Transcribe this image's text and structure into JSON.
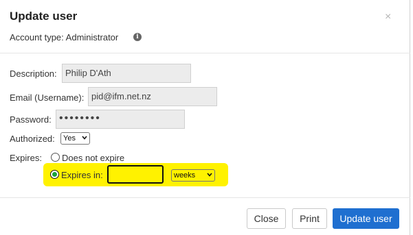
{
  "dialog": {
    "title": "Update user",
    "close_glyph": "×",
    "account_type": "Account type: Administrator",
    "info_icon": "info-circle-icon"
  },
  "form": {
    "description_label": "Description:",
    "description_value": "Philip D'Ath",
    "email_label": "Email (Username):",
    "email_value": "pid@ifm.net.nz",
    "password_label": "Password:",
    "password_value": "••••••••",
    "authorized_label": "Authorized:",
    "authorized_value": "Yes",
    "expires_label": "Expires:",
    "option_never": "Does not expire",
    "option_expires_in": "Expires in:",
    "expires_in_value": "",
    "unit_value": "weeks",
    "selected_option": "expires_in"
  },
  "footer": {
    "close_label": "Close",
    "print_label": "Print",
    "update_label": "Update user"
  },
  "colors": {
    "primary": "#1f6fd0",
    "highlight": "#fff200",
    "radio_checked": "#1aa33a"
  }
}
